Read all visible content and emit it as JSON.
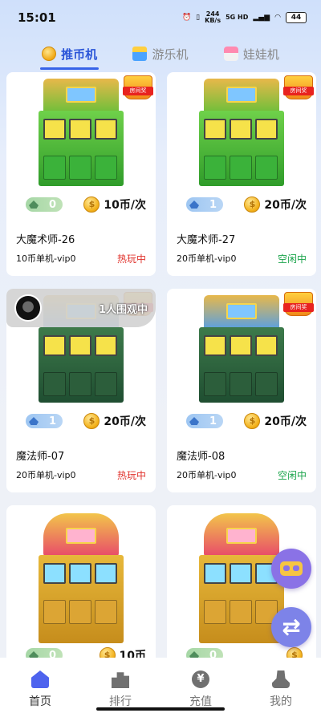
{
  "status_bar": {
    "time": "15:01",
    "net_speed": "244",
    "net_unit": "KB/s",
    "signal": "5G HD",
    "battery": "44"
  },
  "tabs": [
    {
      "label": "推币机",
      "icon": "coin-icon",
      "active": true
    },
    {
      "label": "游乐机",
      "icon": "ride-icon",
      "active": false
    },
    {
      "label": "娃娃机",
      "icon": "doll-machine-icon",
      "active": false
    }
  ],
  "badge_text": "房间奖",
  "coin_glyph": "$",
  "cards": [
    {
      "level": "0",
      "price": "10币/次",
      "name": "大魔术师-26",
      "desc": "10币单机-vip0",
      "status": "热玩中",
      "status_type": "hot",
      "machine": "green",
      "badge": true
    },
    {
      "level": "1",
      "price": "20币/次",
      "name": "大魔术师-27",
      "desc": "20币单机-vip0",
      "status": "空闲中",
      "status_type": "idle",
      "machine": "green",
      "badge": true
    },
    {
      "level": "1",
      "price": "20币/次",
      "name": "魔法师-07",
      "desc": "20币单机-vip0",
      "status": "热玩中",
      "status_type": "hot",
      "machine": "dark",
      "badge": true,
      "viewers": "1人围观中"
    },
    {
      "level": "1",
      "price": "20币/次",
      "name": "魔法师-08",
      "desc": "20币单机-vip0",
      "status": "空闲中",
      "status_type": "idle",
      "machine": "dark",
      "badge": true
    },
    {
      "level": "0",
      "price": "10币",
      "name": "",
      "desc": "",
      "status": "",
      "status_type": "",
      "machine": "yellow",
      "badge": false
    },
    {
      "level": "0",
      "price": "",
      "name": "",
      "desc": "",
      "status": "",
      "status_type": "",
      "machine": "yellow",
      "badge": false
    }
  ],
  "floating": {
    "vr": "vr-glasses-icon",
    "refresh": "refresh-icon",
    "refresh_glyph": "⇄"
  },
  "bottom_nav": [
    {
      "label": "首页",
      "icon": "home-icon",
      "active": true
    },
    {
      "label": "排行",
      "icon": "ranking-icon",
      "active": false
    },
    {
      "label": "充值",
      "icon": "yen-icon",
      "active": false,
      "glyph": "¥"
    },
    {
      "label": "我的",
      "icon": "profile-icon",
      "active": false
    }
  ],
  "colors": {
    "accent": "#3763e8",
    "hot": "#e0302a",
    "idle": "#19a34a",
    "float": "#8a72e6"
  }
}
